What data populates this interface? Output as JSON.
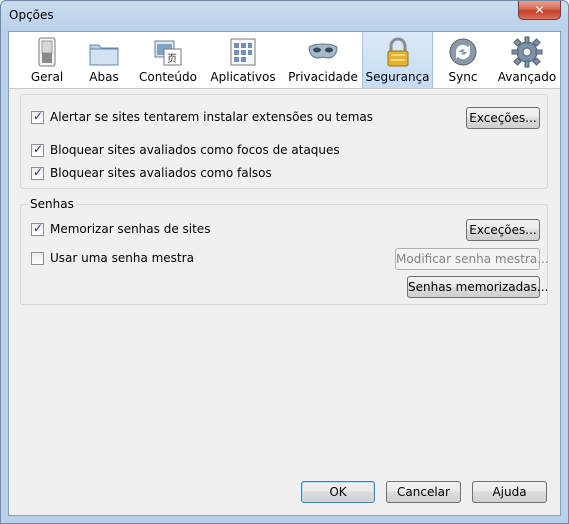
{
  "window": {
    "title": "Opções",
    "close_label": "✕"
  },
  "tabs": [
    {
      "id": "geral",
      "label": "Geral",
      "icon": "switch-icon"
    },
    {
      "id": "abas",
      "label": "Abas",
      "icon": "folder-tabs-icon"
    },
    {
      "id": "conteudo",
      "label": "Conteúdo",
      "icon": "content-icon"
    },
    {
      "id": "aplicativos",
      "label": "Aplicativos",
      "icon": "applications-icon"
    },
    {
      "id": "privacidade",
      "label": "Privacidade",
      "icon": "mask-icon"
    },
    {
      "id": "seguranca",
      "label": "Segurança",
      "icon": "lock-icon",
      "selected": true
    },
    {
      "id": "sync",
      "label": "Sync",
      "icon": "sync-icon"
    },
    {
      "id": "avancado",
      "label": "Avançado",
      "icon": "gear-icon"
    }
  ],
  "security": {
    "alert_addons": {
      "label": "Alertar se sites tentarem instalar extensões ou temas",
      "checked": true
    },
    "exceptions_label": "Exceções...",
    "block_attack": {
      "label": "Bloquear sites avaliados como focos de ataques",
      "checked": true
    },
    "block_forgery": {
      "label": "Bloquear sites avaliados como falsos",
      "checked": true
    }
  },
  "passwords": {
    "title": "Senhas",
    "remember": {
      "label": "Memorizar senhas de sites",
      "checked": true
    },
    "exceptions_label": "Exceções...",
    "master": {
      "label": "Usar uma senha mestra",
      "checked": false
    },
    "change_master_label": "Modificar senha mestra...",
    "saved_passwords_label": "Senhas memorizadas..."
  },
  "footer": {
    "ok_label": "OK",
    "cancel_label": "Cancelar",
    "help_label": "Ajuda"
  },
  "colors": {
    "selected_tab": "#c6dcf3",
    "checkmark": "#1a3a6b",
    "close_button": "#c7402b"
  }
}
